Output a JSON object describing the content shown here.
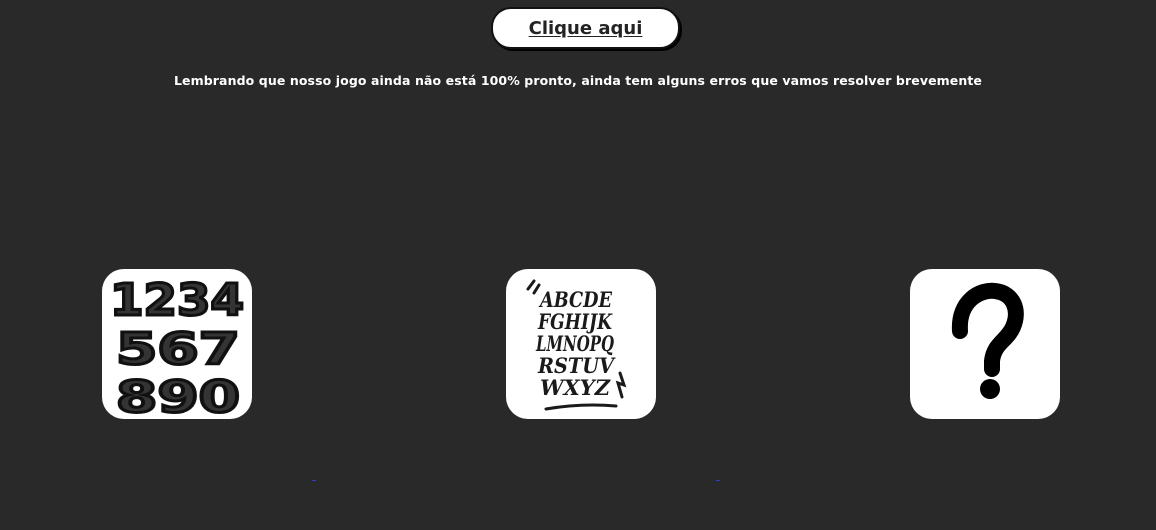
{
  "header": {
    "cta_label": "Clique aqui"
  },
  "notice": {
    "text": "Lembrando que nosso jogo ainda não está 100% pronto, ainda tem alguns erros que vamos resolver brevemente"
  },
  "games": [
    {
      "icon": "numbers-icon",
      "glyph_rows": [
        "1234",
        "567",
        "890"
      ]
    },
    {
      "icon": "graffiti-alphabet-icon",
      "glyph_rows": [
        "ABCDE",
        "FGHIJK",
        "LMNOPQ",
        "RSTUV",
        "WXYZ"
      ]
    },
    {
      "icon": "question-mark-icon",
      "glyph_rows": [
        "?"
      ]
    }
  ],
  "colors": {
    "background": "#292929",
    "button_bg": "#ffffff",
    "button_text": "#232323",
    "notice_text": "#ffffff",
    "card_bg": "#ffffff",
    "glyph": "#111111"
  }
}
